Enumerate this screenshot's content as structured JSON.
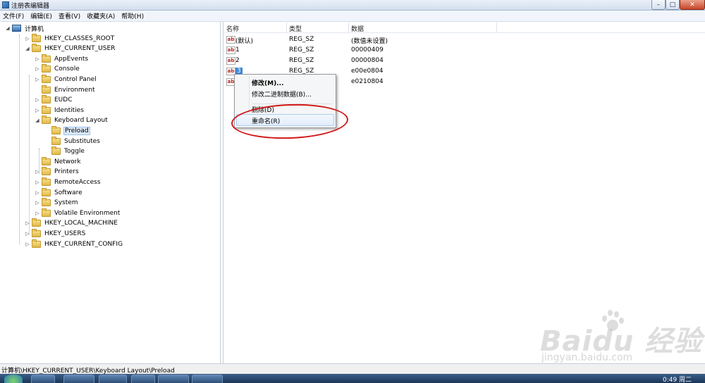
{
  "window": {
    "title": "注册表编辑器"
  },
  "menu": [
    "文件(F)",
    "编辑(E)",
    "查看(V)",
    "收藏夹(A)",
    "帮助(H)"
  ],
  "tree": {
    "root": "计算机",
    "nodes": [
      {
        "label": "HKEY_CLASSES_ROOT",
        "level": 1,
        "expander": "▷"
      },
      {
        "label": "HKEY_CURRENT_USER",
        "level": 1,
        "expander": "◢"
      },
      {
        "label": "AppEvents",
        "level": 2,
        "expander": "▷"
      },
      {
        "label": "Console",
        "level": 2,
        "expander": "▷"
      },
      {
        "label": "Control Panel",
        "level": 2,
        "expander": "▷"
      },
      {
        "label": "Environment",
        "level": 2,
        "expander": ""
      },
      {
        "label": "EUDC",
        "level": 2,
        "expander": "▷"
      },
      {
        "label": "Identities",
        "level": 2,
        "expander": "▷"
      },
      {
        "label": "Keyboard Layout",
        "level": 2,
        "expander": "◢"
      },
      {
        "label": "Preload",
        "level": 3,
        "expander": "",
        "selected": true
      },
      {
        "label": "Substitutes",
        "level": 3,
        "expander": ""
      },
      {
        "label": "Toggle",
        "level": 3,
        "expander": ""
      },
      {
        "label": "Network",
        "level": 2,
        "expander": ""
      },
      {
        "label": "Printers",
        "level": 2,
        "expander": "▷"
      },
      {
        "label": "RemoteAccess",
        "level": 2,
        "expander": "▷"
      },
      {
        "label": "Software",
        "level": 2,
        "expander": "▷"
      },
      {
        "label": "System",
        "level": 2,
        "expander": "▷"
      },
      {
        "label": "Volatile Environment",
        "level": 2,
        "expander": "▷"
      },
      {
        "label": "HKEY_LOCAL_MACHINE",
        "level": 1,
        "expander": "▷"
      },
      {
        "label": "HKEY_USERS",
        "level": 1,
        "expander": "▷"
      },
      {
        "label": "HKEY_CURRENT_CONFIG",
        "level": 1,
        "expander": "▷"
      }
    ]
  },
  "values": {
    "headers": {
      "name": "名称",
      "type": "类型",
      "data": "数据"
    },
    "icon_text": "ab",
    "rows": [
      {
        "name": "(默认)",
        "type": "REG_SZ",
        "data": "(数值未设置)"
      },
      {
        "name": "1",
        "type": "REG_SZ",
        "data": "00000409"
      },
      {
        "name": "2",
        "type": "REG_SZ",
        "data": "00000804"
      },
      {
        "name": "3",
        "type": "REG_SZ",
        "data": "e00e0804",
        "selected": true
      },
      {
        "name": "",
        "type": "",
        "data": "e0210804"
      }
    ]
  },
  "context_menu": {
    "modify": "修改(M)...",
    "modify_binary": "修改二进制数据(B)...",
    "delete": "删除(D)",
    "rename": "重命名(R)"
  },
  "status_path": "计算机\\HKEY_CURRENT_USER\\Keyboard Layout\\Preload",
  "taskbar": {
    "clock": "0:49 周二"
  },
  "watermark": {
    "brand": "Baidu 经验",
    "url": "jingyan.baidu.com"
  },
  "colors": {
    "annotation": "#d01818",
    "selection": "#3b86d6"
  }
}
